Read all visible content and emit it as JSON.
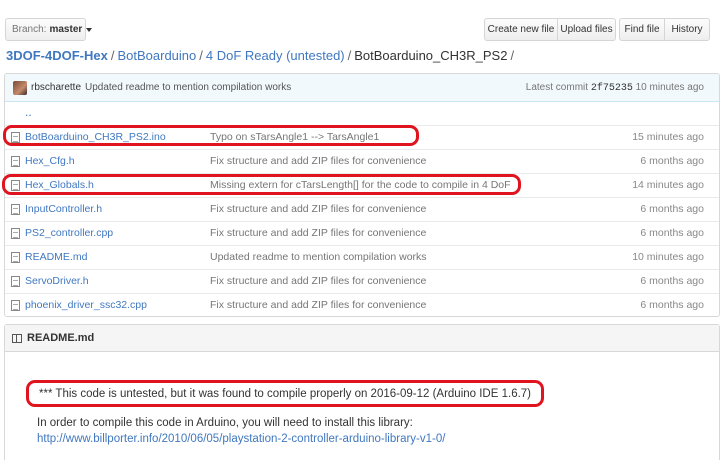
{
  "branch": {
    "label": "Branch:",
    "value": "master"
  },
  "actions": [
    "Create new file",
    "Upload files",
    "Find file",
    "History"
  ],
  "breadcrumb": {
    "root": "3DOF-4DOF-Hex",
    "parts": [
      "BotBoarduino",
      "4 DoF Ready (untested)"
    ],
    "current": "BotBoarduino_CH3R_PS2",
    "sep": "/"
  },
  "commit": {
    "author": "rbscharette",
    "message": "Updated readme to mention compilation works",
    "latest_label": "Latest commit",
    "sha": "2f75235",
    "age": "10 minutes ago"
  },
  "up_dir": "..",
  "files": [
    {
      "name": "BotBoarduino_CH3R_PS2.ino",
      "message": "Typo on sTarsAngle1 --> TarsAngle1",
      "age": "15 minutes ago"
    },
    {
      "name": "Hex_Cfg.h",
      "message": "Fix structure and add ZIP files for convenience",
      "age": "6 months ago"
    },
    {
      "name": "Hex_Globals.h",
      "message": "Missing extern for cTarsLength[] for the code to compile in 4 DoF",
      "age": "14 minutes ago"
    },
    {
      "name": "InputController.h",
      "message": "Fix structure and add ZIP files for convenience",
      "age": "6 months ago"
    },
    {
      "name": "PS2_controller.cpp",
      "message": "Fix structure and add ZIP files for convenience",
      "age": "6 months ago"
    },
    {
      "name": "README.md",
      "message": "Updated readme to mention compilation works",
      "age": "10 minutes ago"
    },
    {
      "name": "ServoDriver.h",
      "message": "Fix structure and add ZIP files for convenience",
      "age": "6 months ago"
    },
    {
      "name": "phoenix_driver_ssc32.cpp",
      "message": "Fix structure and add ZIP files for convenience",
      "age": "6 months ago"
    }
  ],
  "readme": {
    "title": "README.md",
    "note": "*** This code is untested, but it was found to compile properly on 2016-09-12 (Arduino IDE 1.6.7)",
    "paragraph": "In order to compile this code in Arduino, you will need to install this library:",
    "link": "http://www.billporter.info/2010/06/05/playstation-2-controller-arduino-library-v1-0/"
  },
  "colors": {
    "link": "#4078c0",
    "highlight": "#e0141e",
    "commit_bar": "#f2f9fc"
  }
}
